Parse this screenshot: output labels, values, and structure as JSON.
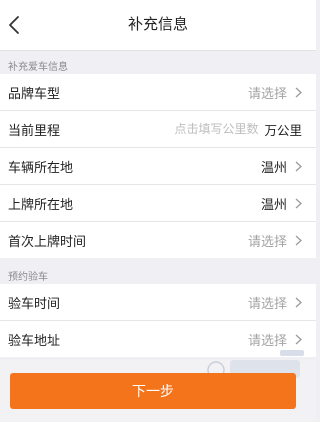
{
  "header": {
    "title": "补充信息",
    "back_icon": "chevron-left-icon"
  },
  "section1": {
    "title": "补充爱车信息",
    "rows": [
      {
        "label": "品牌车型",
        "value": "请选择",
        "state": "placeholder"
      },
      {
        "label": "当前里程",
        "placeholder": "点击填写公里数",
        "unit": "万公里"
      },
      {
        "label": "车辆所在地",
        "value": "温州",
        "state": "filled"
      },
      {
        "label": "上牌所在地",
        "value": "温州",
        "state": "filled"
      },
      {
        "label": "首次上牌时间",
        "value": "请选择",
        "state": "placeholder"
      }
    ]
  },
  "section2": {
    "title": "预约验车",
    "rows": [
      {
        "label": "验车时间",
        "value": "请选择",
        "state": "placeholder"
      },
      {
        "label": "验车地址",
        "value": "请选择",
        "state": "placeholder"
      }
    ]
  },
  "footer": {
    "next_label": "下一步"
  },
  "colors": {
    "accent": "#f4741c",
    "placeholder": "#a4a4a4",
    "background": "#efeff4"
  }
}
